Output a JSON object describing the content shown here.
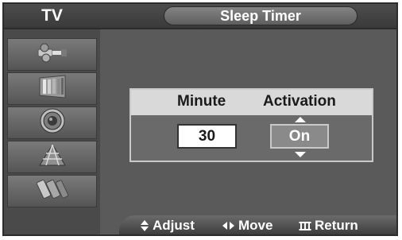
{
  "sidebar": {
    "title": "TV",
    "items": [
      {
        "icon": "input-plug-icon"
      },
      {
        "icon": "picture-icon"
      },
      {
        "icon": "speaker-icon"
      },
      {
        "icon": "channel-antenna-icon"
      },
      {
        "icon": "setup-connectors-icon"
      }
    ]
  },
  "header": {
    "title": "Sleep Timer"
  },
  "panel": {
    "minute_label": "Minute",
    "activation_label": "Activation",
    "minute_value": "30",
    "activation_value": "On"
  },
  "footer": {
    "adjust_label": "Adjust",
    "move_label": "Move",
    "return_label": "Return"
  }
}
